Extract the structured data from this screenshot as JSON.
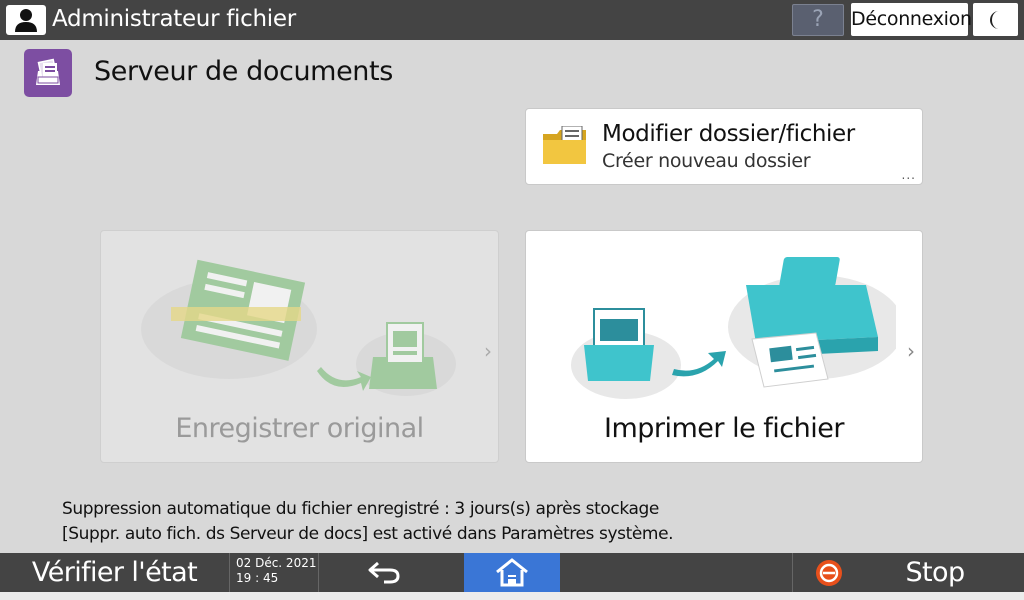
{
  "topbar": {
    "user_title": "Administrateur fichier",
    "help_label": "?",
    "logout_label": "Déconnexion"
  },
  "app": {
    "title": "Serveur de documents"
  },
  "folder_card": {
    "title": "Modifier dossier/fichier",
    "subtitle": "Créer nouveau dossier",
    "more": "..."
  },
  "store_card": {
    "label": "Enregistrer original",
    "enabled": false
  },
  "print_card": {
    "label": "Imprimer le fichier",
    "enabled": true
  },
  "info": {
    "line1": "Suppression automatique du fichier enregistré : 3 jours(s) après stockage",
    "line2": "[Suppr. auto fich. ds Serveur de docs] est activé dans Paramètres système."
  },
  "bottombar": {
    "verify_label": "Vérifier l'état",
    "date": "02 Déc. 2021",
    "time": "19 : 45",
    "stop_label": "Stop"
  },
  "colors": {
    "topbar": "#444444",
    "app_icon": "#7d4ea2",
    "home_active": "#3a76d6",
    "stop_icon": "#e8501c",
    "printer": "#3fc4cc"
  },
  "icons": [
    "user-icon",
    "help-icon",
    "moon-icon",
    "document-server-icon",
    "folder-icon",
    "scan-illustration",
    "print-illustration",
    "back-arrow-icon",
    "home-icon",
    "stop-icon",
    "chevron-right-icon"
  ]
}
